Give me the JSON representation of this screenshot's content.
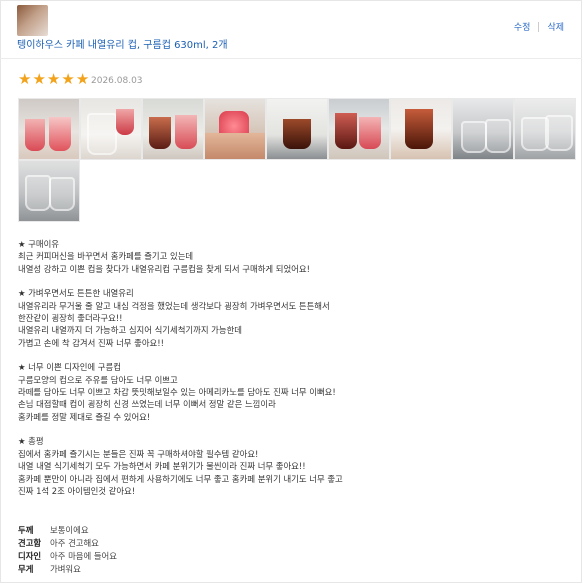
{
  "product": {
    "title": "텡이하우스 카페 내열유리 컵, 구름컵 630ml, 2개"
  },
  "actions": {
    "edit": "수정",
    "delete": "삭제"
  },
  "rating": {
    "value": 5,
    "max": 5,
    "date": "2026.08.03"
  },
  "photos": [
    {
      "name": "photo-1"
    },
    {
      "name": "photo-2"
    },
    {
      "name": "photo-3"
    },
    {
      "name": "photo-4"
    },
    {
      "name": "photo-5"
    },
    {
      "name": "photo-6"
    },
    {
      "name": "photo-7"
    },
    {
      "name": "photo-8"
    },
    {
      "name": "photo-9"
    },
    {
      "name": "photo-10"
    }
  ],
  "review": {
    "sections": [
      {
        "lines": [
          "★ 구매이유",
          "최근 커피머신을 바꾸면서 홈카페를 즐기고 있는데",
          "내열성 강하고 이쁜 컵을 찾다가 내열유리컵 구름컵을 찾게 되서 구매하게 되었어요!"
        ]
      },
      {
        "lines": [
          "★ 가벼우면서도 튼튼한 내열유리",
          "내열유리라 무거울 줄 알고 내심 걱정을 했었는데 생각보다 굉장히 가벼우면서도 튼튼해서",
          "한잔같이 굉장히 좋더라구요!!",
          "내열유리 내열까지 더 가능하고 심지어 식기세척기까지 가능한데",
          "가볍고 손에 착 감겨서 진짜 너무 좋아요!!"
        ]
      },
      {
        "lines": [
          "★ 너무 이쁜 디자인에 구름컵",
          "구름모양의 컵으로 주유를 담아도 너무 이쁘고",
          "라떼를 담아도 너무 이쁘고 차갑 뜻밋해보일수 있는 아메리카노를 담아도 진짜 너무 이뻐요!",
          "손님 대접할때 컵이 굉장히 신경 쓰였는데 너무 이뻐서 정말 같은 느낌이라",
          "홈카페를 정말 제대로 즐길 수 있어요!"
        ]
      },
      {
        "lines": [
          "★ 총평",
          "집에서 홈카페 즐기시는 분들은 진짜 꼭 구매하셔야할 필수템 같아요!",
          "내열 내열 식기세척기 모두 가능하면서 카페 분위기가 물씬이라 진짜 너무 좋아요!!",
          "홈카페 뿐만이 아니라 집에서 편하게 사용하기에도 너무 좋고 홈카페 분위기 내기도 너무 좋고",
          "진짜 1석 2조 아이템인것 같아요!"
        ]
      }
    ]
  },
  "specs": [
    {
      "label": "두께",
      "value": "보통이에요"
    },
    {
      "label": "견고함",
      "value": "아주 견고해요"
    },
    {
      "label": "디자인",
      "value": "아주 마음에 들어요"
    },
    {
      "label": "무게",
      "value": "가벼워요"
    }
  ],
  "colors": {
    "star": "#f2a31b",
    "link": "#1a5fb4"
  }
}
